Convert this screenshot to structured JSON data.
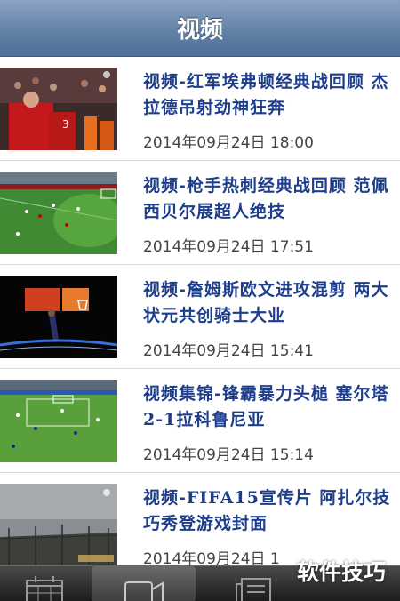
{
  "nav": {
    "title": "视频"
  },
  "items": [
    {
      "title": "视频-红军埃弗顿经典战回顾 杰拉德吊射劲神狂奔",
      "date": "2014年09月24日 18:00"
    },
    {
      "title": "视频-枪手热刺经典战回顾 范佩西贝尔展超人绝技",
      "date": "2014年09月24日 17:51"
    },
    {
      "title": "视频-詹姆斯欧文进攻混剪 两大状元共创骑士大业",
      "date": "2014年09月24日 15:41"
    },
    {
      "title": "视频集锦-锋霸暴力头槌 塞尔塔2-1拉科鲁尼亚",
      "date": "2014年09月24日 15:14"
    },
    {
      "title": "视频-FIFA15宣传片 阿扎尔技巧秀登游戏封面",
      "date": "2014年09月24日 1"
    }
  ],
  "tabbar": {
    "tabs": [
      "calendar-icon",
      "video-camera-icon",
      "news-icon"
    ],
    "active": 1
  },
  "watermark": "软件技巧",
  "colors": {
    "nav": "#5f7fa5",
    "headline": "#1e3e8c",
    "tabbar": "#2a2a2a"
  }
}
